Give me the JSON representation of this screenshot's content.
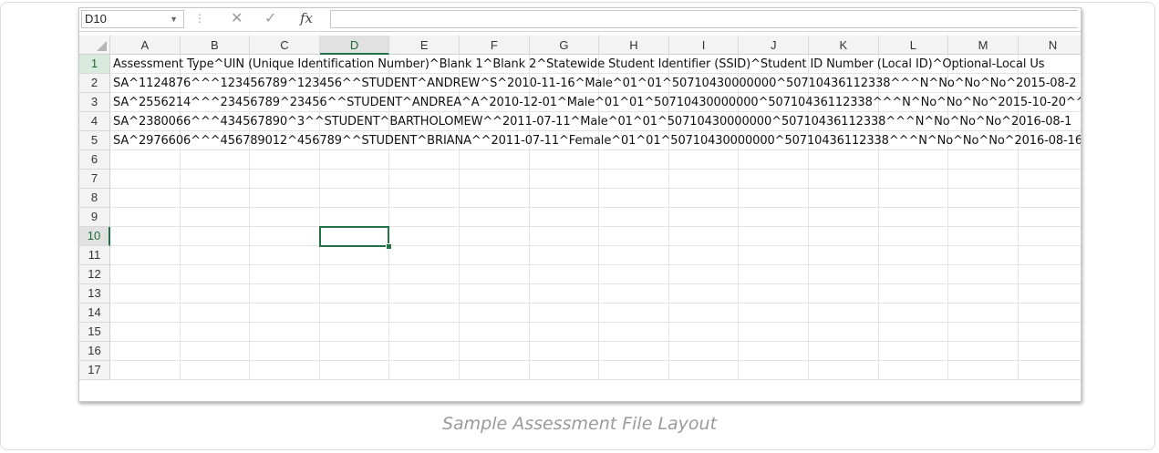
{
  "formula_bar": {
    "name_box": "D10",
    "cancel_icon": "✕",
    "enter_icon": "✓",
    "fx_label": "fx",
    "formula_value": ""
  },
  "columns": [
    "A",
    "B",
    "C",
    "D",
    "E",
    "F",
    "G",
    "H",
    "I",
    "J",
    "K",
    "L",
    "M",
    "N"
  ],
  "rows": [
    {
      "num": "1",
      "text": "Assessment Type^UIN (Unique Identification Number)^Blank 1^Blank 2^Statewide Student Identifier (SSID)^Student ID Number (Local ID)^Optional-Local Us"
    },
    {
      "num": "2",
      "text": "SA^1124876^^^123456789^123456^^STUDENT^ANDREW^S^2010-11-16^Male^01^01^50710430000000^50710436112338^^^N^No^No^No^2015-08-2"
    },
    {
      "num": "3",
      "text": "SA^2556214^^^23456789^23456^^STUDENT^ANDREA^A^2010-12-01^Male^01^01^50710430000000^50710436112338^^^N^No^No^No^2015-10-20^^"
    },
    {
      "num": "4",
      "text": "SA^2380066^^^434567890^3^^STUDENT^BARTHOLOMEW^^2011-07-11^Male^01^01^50710430000000^50710436112338^^^N^No^No^No^2016-08-1"
    },
    {
      "num": "5",
      "text": "SA^2976606^^^456789012^456789^^STUDENT^BRIANA^^2011-07-11^Female^01^01^50710430000000^50710436112338^^^N^No^No^No^2016-08-16"
    },
    {
      "num": "6",
      "text": ""
    },
    {
      "num": "7",
      "text": ""
    },
    {
      "num": "8",
      "text": ""
    },
    {
      "num": "9",
      "text": ""
    },
    {
      "num": "10",
      "text": ""
    },
    {
      "num": "11",
      "text": ""
    },
    {
      "num": "12",
      "text": ""
    },
    {
      "num": "13",
      "text": ""
    },
    {
      "num": "14",
      "text": ""
    },
    {
      "num": "15",
      "text": ""
    },
    {
      "num": "16",
      "text": ""
    },
    {
      "num": "17",
      "text": ""
    }
  ],
  "active_cell": {
    "column": "D",
    "row": "10"
  },
  "colors": {
    "accent": "#217346",
    "header_bg": "#f3f3f3",
    "gridline": "#e3e3e3"
  },
  "caption": "Sample Assessment File Layout"
}
